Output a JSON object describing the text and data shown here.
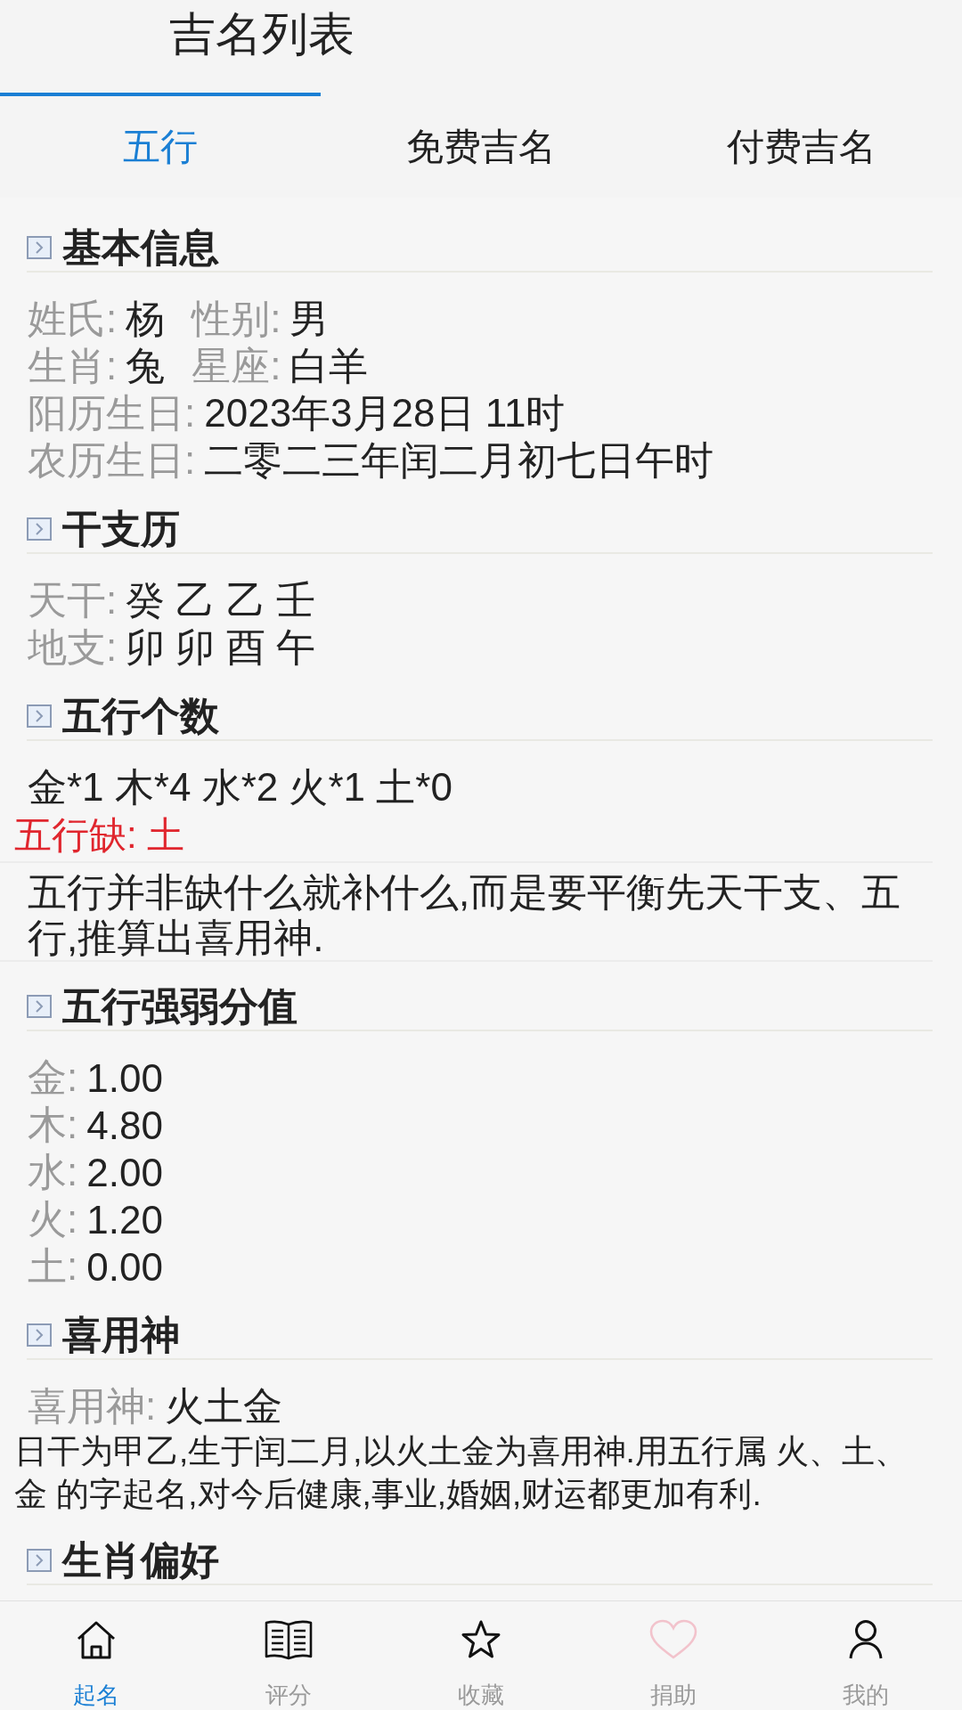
{
  "title": "吉名列表",
  "tabs": [
    {
      "label": "五行",
      "selected": true
    },
    {
      "label": "免费吉名",
      "selected": false
    },
    {
      "label": "付费吉名",
      "selected": false
    }
  ],
  "sections": [
    {
      "title": "基本信息",
      "rows": [
        {
          "kind": "fields",
          "fields": [
            {
              "label": "姓氏:",
              "value": "杨"
            },
            {
              "label": "性别:",
              "value": "男"
            }
          ]
        },
        {
          "kind": "fields",
          "fields": [
            {
              "label": "生肖:",
              "value": "兔"
            },
            {
              "label": "星座:",
              "value": "白羊"
            }
          ]
        },
        {
          "kind": "fields",
          "fields": [
            {
              "label": "阳历生日:",
              "value": "2023年3月28日 11时"
            }
          ]
        },
        {
          "kind": "fields",
          "fields": [
            {
              "label": "农历生日:",
              "value": "二零二三年闰二月初七日午时"
            }
          ]
        }
      ]
    },
    {
      "title": "干支历",
      "rows": [
        {
          "kind": "fields",
          "fields": [
            {
              "label": "天干:",
              "value": "癸 乙 乙 壬"
            }
          ]
        },
        {
          "kind": "fields",
          "fields": [
            {
              "label": "地支:",
              "value": "卯 卯 酉 午"
            }
          ]
        }
      ]
    },
    {
      "title": "五行个数",
      "rows": [
        {
          "kind": "text",
          "text": "金*1 木*4 水*2 火*1 土*0"
        },
        {
          "kind": "warning",
          "text": "五行缺: 土"
        },
        {
          "kind": "note",
          "text": "五行并非缺什么就补什么,而是要平衡先天干支、五行,推算出喜用神."
        }
      ]
    },
    {
      "title": "五行强弱分值",
      "rows": [
        {
          "kind": "fields",
          "fields": [
            {
              "label": "金:",
              "value": "1.00"
            }
          ]
        },
        {
          "kind": "fields",
          "fields": [
            {
              "label": "木:",
              "value": "4.80"
            }
          ]
        },
        {
          "kind": "fields",
          "fields": [
            {
              "label": "水:",
              "value": "2.00"
            }
          ]
        },
        {
          "kind": "fields",
          "fields": [
            {
              "label": "火:",
              "value": "1.20"
            }
          ]
        },
        {
          "kind": "fields",
          "fields": [
            {
              "label": "土:",
              "value": "0.00"
            }
          ]
        }
      ]
    },
    {
      "title": "喜用神",
      "rows": [
        {
          "kind": "fields",
          "fields": [
            {
              "label": "喜用神:",
              "value": "火土金"
            }
          ]
        },
        {
          "kind": "paragraph",
          "text": "日干为甲乙,生于闰二月,以火土金为喜用神.用五行属 火、土、金 的字起名,对今后健康,事业,婚姻,财运都更加有利."
        }
      ]
    },
    {
      "title": "生肖偏好"
    }
  ],
  "nav": [
    {
      "label": "起名",
      "kind": "home",
      "selected": true
    },
    {
      "label": "评分",
      "kind": "book",
      "selected": false
    },
    {
      "label": "收藏",
      "kind": "star",
      "selected": false
    },
    {
      "label": "捐助",
      "kind": "heart",
      "selected": false
    },
    {
      "label": "我的",
      "kind": "person",
      "selected": false
    }
  ]
}
